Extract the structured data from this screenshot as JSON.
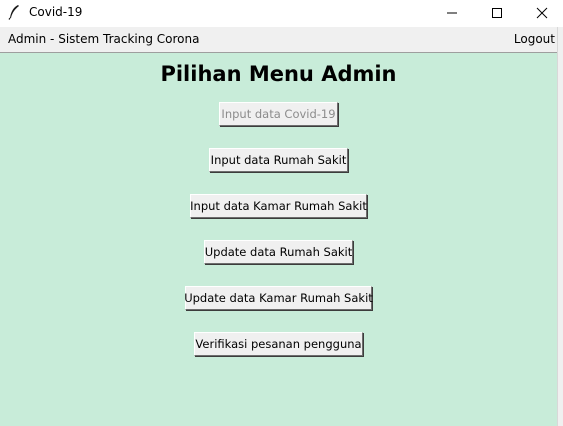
{
  "window": {
    "title": "Covid-19",
    "app_icon": "feather-icon"
  },
  "menubar": {
    "title": "Admin - Sistem Tracking Corona",
    "logout_label": "Logout"
  },
  "main": {
    "heading": "Pilihan Menu Admin",
    "buttons": [
      {
        "label": "Input data Covid-19",
        "enabled": false
      },
      {
        "label": "Input data Rumah Sakit",
        "enabled": true
      },
      {
        "label": "Input data Kamar Rumah Sakit",
        "enabled": true
      },
      {
        "label": "Update data Rumah Sakit",
        "enabled": true
      },
      {
        "label": "Update data Kamar Rumah Sakit",
        "enabled": true
      },
      {
        "label": "Verifikasi pesanan pengguna",
        "enabled": true
      }
    ]
  },
  "colors": {
    "content_background": "#c8ecd9",
    "menubar_background": "#f0f0f0",
    "button_background": "#f0f0f0",
    "disabled_text": "#8c8c8c"
  }
}
